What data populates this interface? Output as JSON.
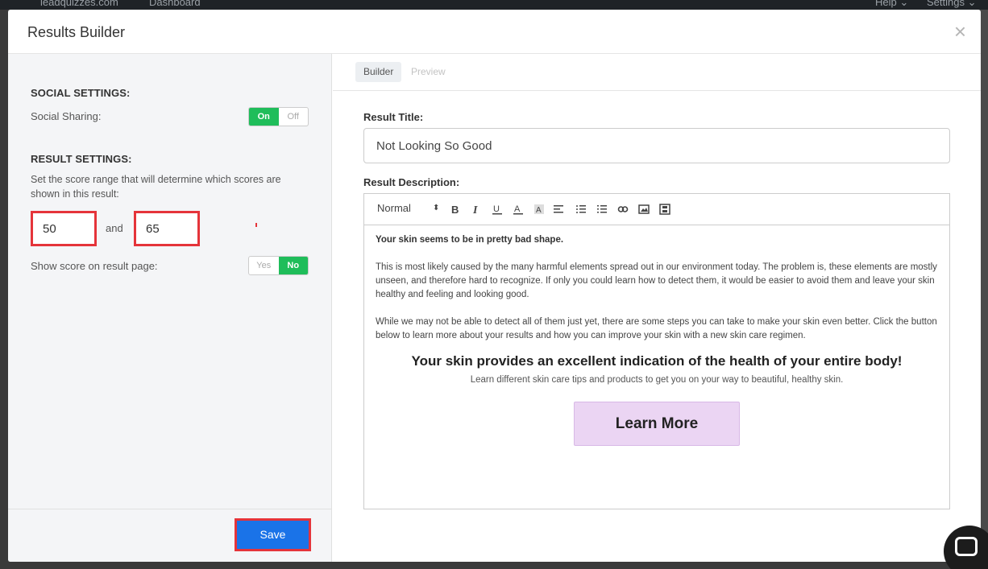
{
  "backdrop": {
    "site": "leadquizzes.com",
    "nav_dashboard": "Dashboard",
    "nav_help": "Help ⌄",
    "nav_settings": "Settings ⌄"
  },
  "modal": {
    "title": "Results Builder",
    "close_icon": "close-icon"
  },
  "left": {
    "social_title": "SOCIAL SETTINGS:",
    "social_sharing_label": "Social Sharing:",
    "social_toggle": {
      "on": "On",
      "off": "Off",
      "selected": "On"
    },
    "result_title": "RESULT SETTINGS:",
    "result_desc": "Set the score range that will determine which scores are shown in this result:",
    "range_min": "50",
    "range_and": "and",
    "range_max": "65",
    "show_score_label": "Show score on result page:",
    "score_toggle": {
      "yes": "Yes",
      "no": "No",
      "selected": "No"
    },
    "save_label": "Save"
  },
  "right": {
    "tabs": [
      {
        "label": "Builder",
        "active": true
      },
      {
        "label": "Preview",
        "active": false
      }
    ],
    "result_title_label": "Result Title:",
    "result_title_value": "Not Looking So Good",
    "result_desc_label": "Result Description:",
    "toolbar": {
      "format": "Normal",
      "icons": [
        "bold-icon",
        "italic-icon",
        "underline-icon",
        "font-color-icon",
        "background-color-icon",
        "align-icon",
        "bullet-list-icon",
        "ordered-list-icon",
        "link-icon",
        "image-icon",
        "video-icon"
      ]
    },
    "content": {
      "heading": "Your skin seems to be in pretty bad shape.",
      "para1": "This is most likely caused by the many harmful elements spread out in our environment today. The problem is, these elements are mostly unseen, and therefore hard to recognize. If only you could learn how to detect them, it would be easier to avoid them and leave your skin healthy and feeling and looking good.",
      "para2": "While we may not be able to detect all of them just yet, there are some steps you can take to make your skin even better. Click the button below to learn more about your results and how you can improve your skin with a new skin care regimen.",
      "big_heading": "Your skin provides an excellent indication of the health of your entire body!",
      "sub_heading": "Learn different skin care tips and products to get you on your way to beautiful, healthy skin.",
      "button_label": "Learn More"
    }
  },
  "colors": {
    "toggle_active": "#1fbd5a",
    "save_button": "#1a73e8",
    "highlight_border": "#e5343a",
    "learn_more_bg": "#ebd5f3"
  }
}
